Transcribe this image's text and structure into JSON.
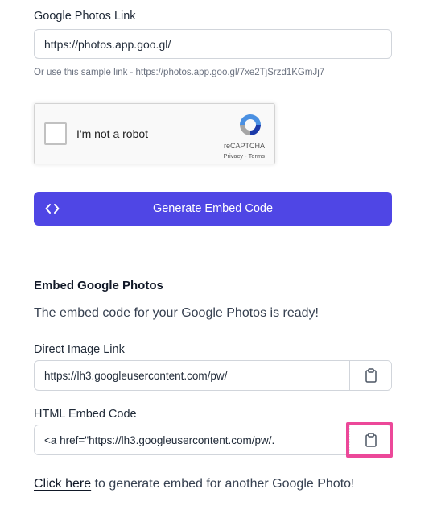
{
  "form": {
    "link_label": "Google Photos Link",
    "link_value": "https://photos.app.goo.gl/",
    "sample_help": "Or use this sample link - https://photos.app.goo.gl/7xe2TjSrzd1KGmJj7",
    "recaptcha": {
      "label": "I'm not a robot",
      "brand": "reCAPTCHA",
      "links": "Privacy - Terms"
    },
    "generate_label": "Generate Embed Code"
  },
  "result": {
    "title": "Embed Google Photos",
    "ready_text": "The embed code for your Google Photos is ready!",
    "direct_label": "Direct Image Link",
    "direct_value": "https://lh3.googleusercontent.com/pw/",
    "html_label": "HTML Embed Code",
    "html_value": "<a href=\"https://lh3.googleusercontent.com/pw/."
  },
  "footer": {
    "link_text": "Click here",
    "rest_text": " to generate embed for another Google Photo!"
  },
  "colors": {
    "primary": "#4f46e5",
    "highlight": "#ec4899"
  },
  "icons": [
    "code-icon",
    "recaptcha-logo-icon",
    "clipboard-icon"
  ]
}
